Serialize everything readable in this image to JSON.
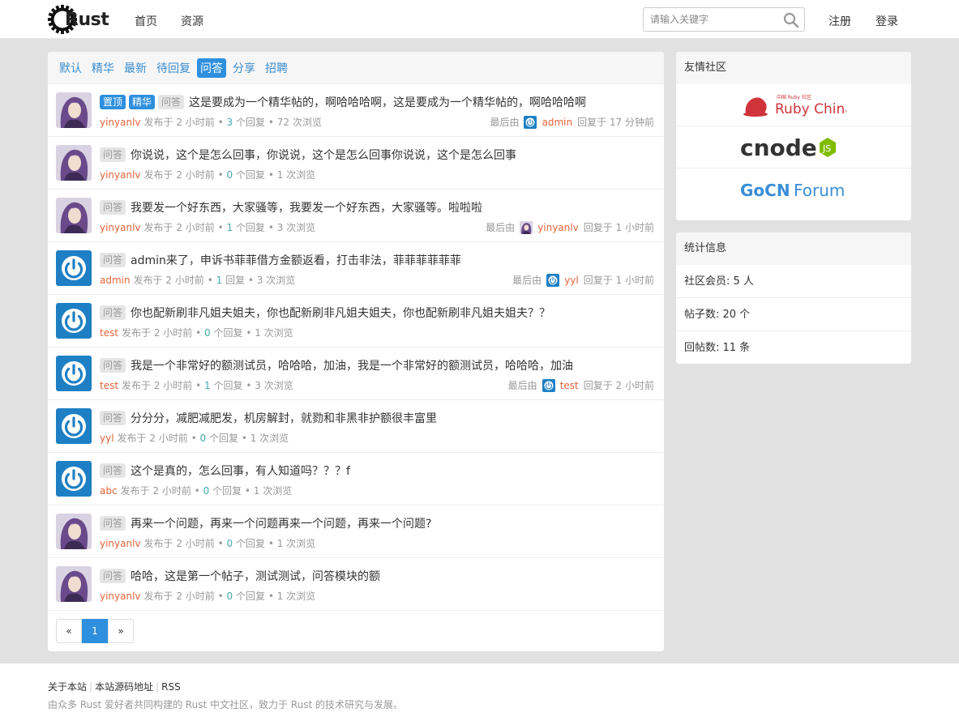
{
  "header": {
    "logo_text": "Rust",
    "nav": [
      "首页",
      "资源"
    ],
    "search_placeholder": "请输入关键字",
    "register": "注册",
    "login": "登录"
  },
  "tabs": [
    "默认",
    "精华",
    "最新",
    "待回复",
    "问答",
    "分享",
    "招聘"
  ],
  "active_tab": "问答",
  "labels": {
    "top": "置顶",
    "good": "精华",
    "qa": "问答",
    "posted": "发布于",
    "last_reply_by": "最后由",
    "replied_at": "回复于"
  },
  "topics": [
    {
      "avatar": "anime",
      "top": "置顶",
      "good": "精华",
      "qa": "问答",
      "title": "这是要成为一个精华帖的，啊哈哈哈啊，这是要成为一个精华帖的，啊哈哈哈啊",
      "author": "yinyanlv",
      "posted": "发布于 2 小时前",
      "replies": "3",
      "replies_label": "个回复",
      "views": "72 次浏览",
      "last_prefix": "最后由",
      "last_user": "admin",
      "last_avatar": "power",
      "last_time": "回复于 17 分钟前"
    },
    {
      "avatar": "anime",
      "qa": "问答",
      "title": "你说说，这个是怎么回事，你说说，这个是怎么回事你说说，这个是怎么回事",
      "author": "yinyanlv",
      "posted": "发布于 2 小时前",
      "replies": "0",
      "replies_label": "个回复",
      "views": "1 次浏览"
    },
    {
      "avatar": "anime",
      "qa": "问答",
      "title": "我要发一个好东西，大家骚等，我要发一个好东西，大家骚等。啦啦啦",
      "author": "yinyanlv",
      "posted": "发布于 2 小时前",
      "replies": "1",
      "replies_label": "个回复",
      "views": "3 次浏览",
      "last_prefix": "最后由",
      "last_user": "yinyanlv",
      "last_avatar": "anime",
      "last_time": "回复于 1 小时前"
    },
    {
      "avatar": "power",
      "qa": "问答",
      "title": "admin来了，申诉书菲菲借方金额返看，打击非法，菲菲菲菲菲菲",
      "author": "admin",
      "posted": "发布于 2 小时前",
      "replies": "1",
      "replies_label": "回复",
      "views": "3 次浏览",
      "last_prefix": "最后由",
      "last_user": "yyl",
      "last_avatar": "power",
      "last_time": "回复于 1 小时前"
    },
    {
      "avatar": "power",
      "qa": "问答",
      "title": "你也配新刷非凡姐夫姐夫，你也配新刷非凡姐夫姐夫，你也配新刷非凡姐夫姐夫？？",
      "author": "test",
      "posted": "发布于 2 小时前",
      "replies": "0",
      "replies_label": "个回复",
      "views": "1 次浏览"
    },
    {
      "avatar": "power",
      "qa": "问答",
      "title": "我是一个非常好的额测试员，哈哈哈，加油，我是一个非常好的额测试员，哈哈哈，加油",
      "author": "test",
      "posted": "发布于 2 小时前",
      "replies": "1",
      "replies_label": "个回复",
      "views": "3 次浏览",
      "last_prefix": "最后由",
      "last_user": "test",
      "last_avatar": "power",
      "last_time": "回复于 2 小时前"
    },
    {
      "avatar": "power",
      "qa": "问答",
      "title": "分分分，减肥减肥发，机房解封，就勠和非黑非护额很丰富里",
      "author": "yyl",
      "posted": "发布于 2 小时前",
      "replies": "0",
      "replies_label": "个回复",
      "views": "1 次浏览"
    },
    {
      "avatar": "power",
      "qa": "问答",
      "title": "这个是真的，怎么回事，有人知道吗？？？f",
      "author": "abc",
      "posted": "发布于 2 小时前",
      "replies": "0",
      "replies_label": "个回复",
      "views": "1 次浏览"
    },
    {
      "avatar": "anime",
      "qa": "问答",
      "title": "再来一个问题，再来一个问题再来一个问题，再来一个问题?",
      "author": "yinyanlv",
      "posted": "发布于 2 小时前",
      "replies": "0",
      "replies_label": "个回复",
      "views": "1 次浏览"
    },
    {
      "avatar": "anime",
      "qa": "问答",
      "title": "哈哈，这是第一个帖子，测试测试，问答模块的额",
      "author": "yinyanlv",
      "posted": "发布于 2 小时前",
      "replies": "0",
      "replies_label": "个回复",
      "views": "1 次浏览"
    }
  ],
  "pager": {
    "prev": "«",
    "current": "1",
    "next": "»"
  },
  "sidebar": {
    "friends_title": "友情社区",
    "friends": [
      {
        "name": "Ruby China",
        "small": "中国 Ruby 社区",
        "color": "#d1333a"
      },
      {
        "name": "cnode",
        "badge": "JS",
        "color": "#333333",
        "accent": "#80bd01"
      },
      {
        "name": "GoCN",
        "suffix": "Forum",
        "color": "#3a8ed8"
      }
    ],
    "stats_title": "统计信息",
    "stats": [
      "社区会员: 5 人",
      "帖子数: 20 个",
      "回帖数: 11 条"
    ]
  },
  "footer": {
    "links": [
      "关于本站",
      "本站源码地址",
      "RSS"
    ],
    "desc": "由众多 Rust 爱好者共同构建的 Rust 中文社区，致力于 Rust 的技术研究与发展。"
  },
  "colors": {
    "accent": "#2e8fde",
    "author": "#e3643a",
    "reply_count": "#44aaaa",
    "ruby": "#d1333a",
    "node_green": "#80bd01",
    "go_blue": "#3a8ed8"
  }
}
